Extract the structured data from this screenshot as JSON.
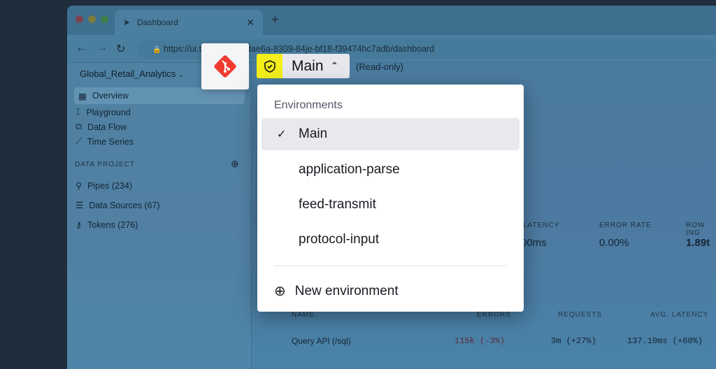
{
  "browser": {
    "tab_title": "Dashboard",
    "url": "https://ui.tinybird.co/8dae6a-8309-84je-bf18-f39474hc7adb/dashboard"
  },
  "workspace": {
    "name": "Global_Retail_Analytics"
  },
  "sidebar": {
    "items": [
      {
        "label": "Overview"
      },
      {
        "label": "Playground"
      },
      {
        "label": "Data Flow"
      },
      {
        "label": "Time Series"
      }
    ],
    "section": "DATA PROJECT",
    "project_items": [
      {
        "label": "Pipes (234)"
      },
      {
        "label": "Data Sources (67)"
      },
      {
        "label": "Tokens (276)"
      }
    ]
  },
  "env": {
    "current": "Main",
    "mode": "(Read-only)",
    "accent": "#f3ee1c"
  },
  "dropdown": {
    "header": "Environments",
    "options": [
      {
        "label": "Main",
        "selected": true
      },
      {
        "label": "application-parse"
      },
      {
        "label": "feed-transmit"
      },
      {
        "label": "protocol-input"
      }
    ],
    "new_label": "New environment"
  },
  "metrics": [
    {
      "label": "LATENCY",
      "value": "00ms"
    },
    {
      "label": "ERROR RATE",
      "value": "0.00%"
    },
    {
      "label": "ROW ING",
      "value": "1.89t"
    }
  ],
  "table": {
    "headers": [
      "NAME",
      "ERRORS",
      "REQUESTS",
      "AVG. LATENCY"
    ],
    "rows": [
      {
        "name": "Query API (/sql)",
        "errors": "115k (-3%)",
        "requests": "3m (+27%)",
        "latency": "137.10ms (+60%)"
      }
    ]
  }
}
